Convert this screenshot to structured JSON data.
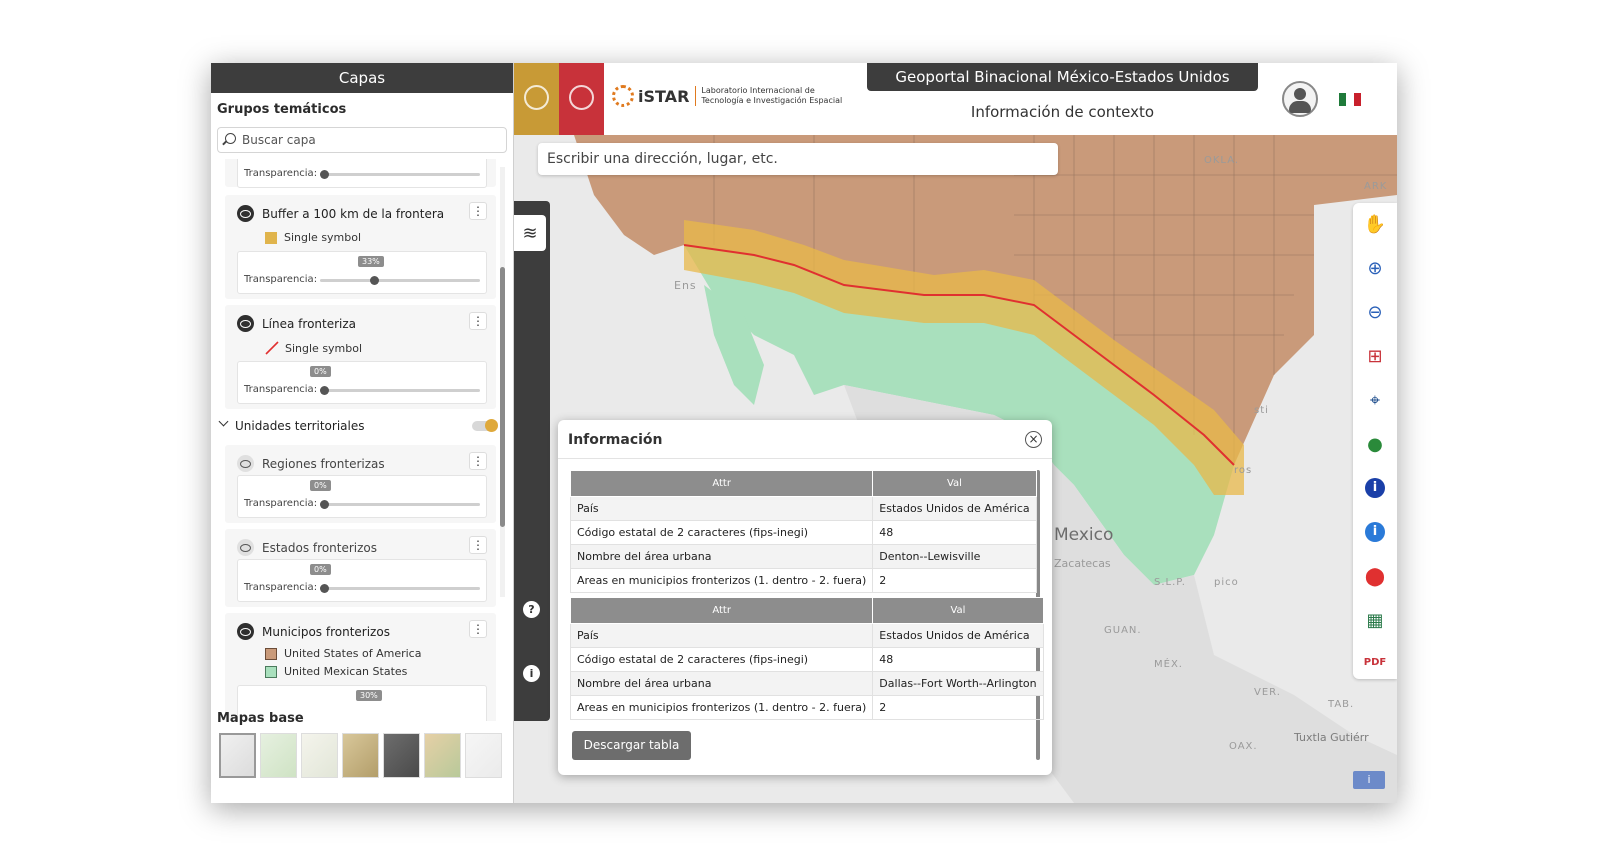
{
  "sidebar": {
    "header": "Capas",
    "groups_title": "Grupos temáticos",
    "search_placeholder": "Buscar capa",
    "transparency_label": "Transparencia:",
    "layers": [
      {
        "name": "Buffer a 100 km de la frontera",
        "legend": [
          "Single symbol"
        ],
        "transparency": "33%"
      },
      {
        "name": "Línea fronteriza",
        "legend": [
          "Single symbol"
        ],
        "transparency": "0%"
      }
    ],
    "group_units": "Unidades territoriales",
    "unit_layers": [
      {
        "name": "Regiones fronterizas",
        "transparency": "0%"
      },
      {
        "name": "Estados fronterizos",
        "transparency": "0%"
      },
      {
        "name": "Municipos fronterizos",
        "legend": [
          "United States of America",
          "United Mexican States"
        ],
        "transparency": "30%"
      }
    ],
    "basemaps_title": "Mapas base"
  },
  "header": {
    "title": "Geoportal Binacional México-Estados Unidos",
    "subtitle": "Información de contexto",
    "istar_name": "iSTAR",
    "istar_desc": "Laboratorio Internacional de Tecnología e Investigación Espacial"
  },
  "map": {
    "search_placeholder": "Escribir una dirección, lugar, etc.",
    "labels": {
      "okla": "OKLA.",
      "ark": "ARK",
      "mexico": "Mexico",
      "zacatecas": "Zacatecas",
      "slp": "S.L.P.",
      "guan": "GUAN.",
      "mex": "MÉX.",
      "ver": "VER.",
      "tab": "TAB.",
      "oax": "OAX.",
      "tuxtla": "Tuxtla Gutiérr",
      "ens": "Ens",
      "sti": "sti",
      "ros": "ros",
      "pico": "pico"
    }
  },
  "popup": {
    "title": "Información",
    "headers": [
      "Attr",
      "Val"
    ],
    "tables": [
      [
        [
          "País",
          "Estados Unidos de América"
        ],
        [
          "Código estatal de 2 caracteres (fips-inegi)",
          "48"
        ],
        [
          "Nombre del área urbana",
          "Denton--Lewisville"
        ],
        [
          "Areas en municipios fronterizos (1. dentro - 2. fuera)",
          "2"
        ]
      ],
      [
        [
          "País",
          "Estados Unidos de América"
        ],
        [
          "Código estatal de 2 caracteres (fips-inegi)",
          "48"
        ],
        [
          "Nombre del área urbana",
          "Dallas--Fort Worth--Arlington"
        ],
        [
          "Areas en municipios fronterizos (1. dentro - 2. fuera)",
          "2"
        ]
      ]
    ],
    "download_label": "Descargar tabla"
  },
  "colors": {
    "usa": "#c99a7a",
    "mexico": "#a9e0bd",
    "buffer": "#e8b84a",
    "border_line": "#e03030",
    "accent_toggle": "#dfa93b"
  },
  "icons": [
    "search-icon",
    "eye-icon",
    "kebab-icon",
    "layers-icon",
    "help-icon",
    "info-icon",
    "hand-pan-icon",
    "zoom-in-icon",
    "zoom-out-icon",
    "zoom-box-icon",
    "locate-icon",
    "globe-icon",
    "info-circle-icon",
    "info-alt-icon",
    "map-pin-icon",
    "clear-layers-icon",
    "pdf-icon"
  ]
}
